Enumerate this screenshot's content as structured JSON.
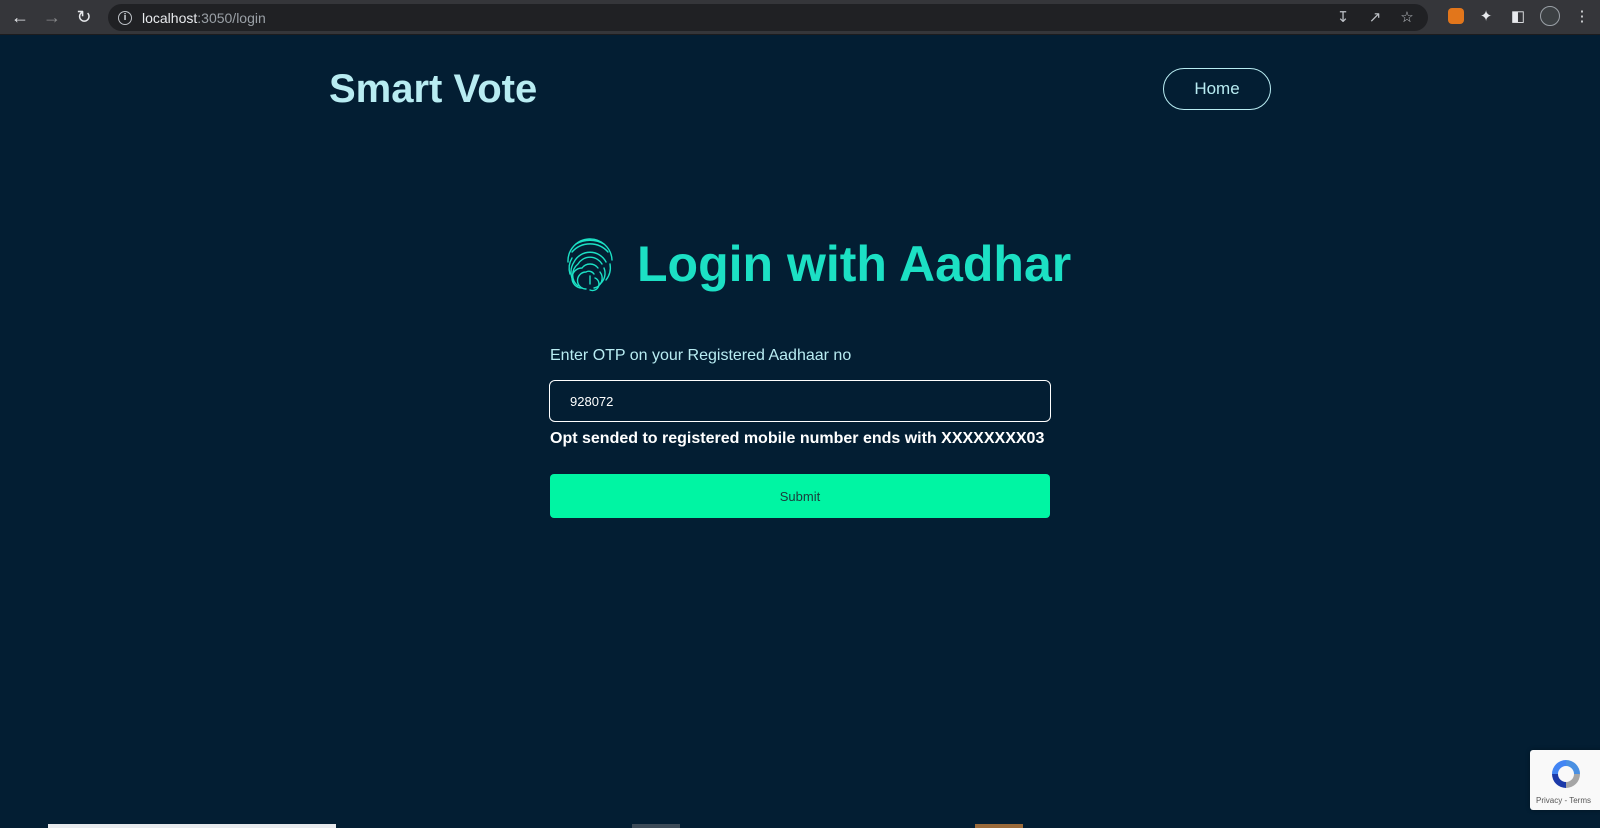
{
  "browser": {
    "url_host": "localhost",
    "url_path": ":3050/login"
  },
  "header": {
    "brand": "Smart Vote",
    "home_label": "Home"
  },
  "login": {
    "title": "Login with Aadhar",
    "otp_label": "Enter OTP on your Registered Aadhaar no",
    "otp_value": "928072",
    "otp_note": "Opt sended to registered mobile number ends with XXXXXXXX03",
    "submit_label": "Submit"
  },
  "recaptcha": {
    "privacy": "Privacy",
    "separator": " - ",
    "terms": "Terms"
  },
  "colors": {
    "background": "#031e33",
    "brand": "#b8ecf2",
    "accent": "#1ce0c4",
    "submit": "#00f5a3"
  }
}
